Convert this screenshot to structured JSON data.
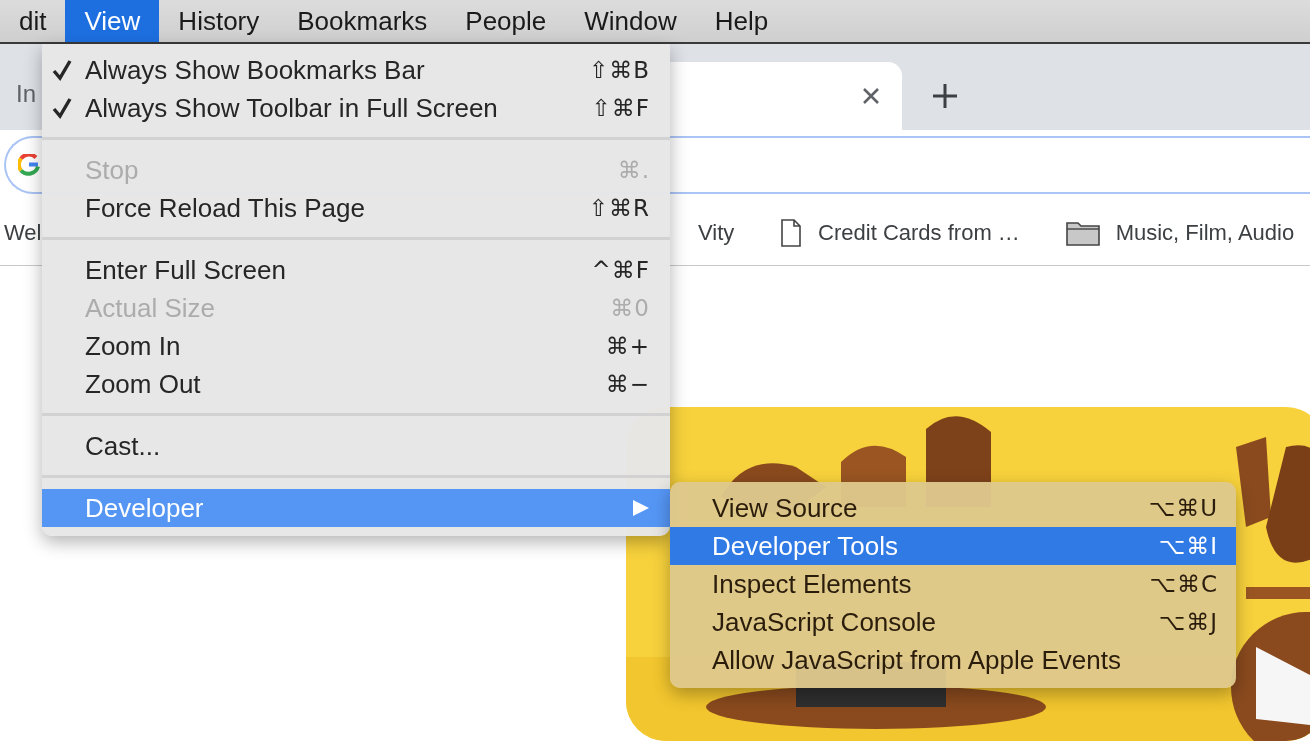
{
  "menu_bar": [
    {
      "label": "dit",
      "selected": false
    },
    {
      "label": "View",
      "selected": true
    },
    {
      "label": "History",
      "selected": false
    },
    {
      "label": "Bookmarks",
      "selected": false
    },
    {
      "label": "People",
      "selected": false
    },
    {
      "label": "Window",
      "selected": false
    },
    {
      "label": "Help",
      "selected": false
    }
  ],
  "tab_strip": {
    "background_tab_label": "In"
  },
  "bookmarks_bar": [
    {
      "label": "Wel",
      "kind": "plain"
    },
    {
      "label": "Vity",
      "kind": "plain"
    },
    {
      "label": "Credit Cards from …",
      "kind": "page"
    },
    {
      "label": "Music, Film, Audio",
      "kind": "folder"
    }
  ],
  "view_menu": {
    "groups": [
      {
        "items": [
          {
            "label": "Always Show Bookmarks Bar",
            "shortcut": "⇧⌘B",
            "checked": true,
            "disabled": false,
            "selected": false,
            "submenu": false
          },
          {
            "label": "Always Show Toolbar in Full Screen",
            "shortcut": "⇧⌘F",
            "checked": true,
            "disabled": false,
            "selected": false,
            "submenu": false
          }
        ]
      },
      {
        "items": [
          {
            "label": "Stop",
            "shortcut": "⌘.",
            "checked": false,
            "disabled": true,
            "selected": false,
            "submenu": false
          },
          {
            "label": "Force Reload This Page",
            "shortcut": "⇧⌘R",
            "checked": false,
            "disabled": false,
            "selected": false,
            "submenu": false
          }
        ]
      },
      {
        "items": [
          {
            "label": "Enter Full Screen",
            "shortcut": "^⌘F",
            "checked": false,
            "disabled": false,
            "selected": false,
            "submenu": false
          },
          {
            "label": "Actual Size",
            "shortcut": "⌘0",
            "checked": false,
            "disabled": true,
            "selected": false,
            "submenu": false
          },
          {
            "label": "Zoom In",
            "shortcut": "⌘+",
            "checked": false,
            "disabled": false,
            "selected": false,
            "submenu": false
          },
          {
            "label": "Zoom Out",
            "shortcut": "⌘−",
            "checked": false,
            "disabled": false,
            "selected": false,
            "submenu": false
          }
        ]
      },
      {
        "items": [
          {
            "label": "Cast...",
            "checked": false,
            "disabled": false,
            "selected": false,
            "submenu": false
          }
        ]
      },
      {
        "items": [
          {
            "label": "Developer",
            "checked": false,
            "disabled": false,
            "selected": true,
            "submenu": true
          }
        ]
      }
    ]
  },
  "developer_submenu": {
    "items": [
      {
        "label": "View Source",
        "shortcut": "⌥⌘U",
        "selected": false
      },
      {
        "label": "Developer Tools",
        "shortcut": "⌥⌘I",
        "selected": true
      },
      {
        "label": "Inspect Elements",
        "shortcut": "⌥⌘C",
        "selected": false
      },
      {
        "label": "JavaScript Console",
        "shortcut": "⌥⌘J",
        "selected": false
      },
      {
        "label": "Allow JavaScript from Apple Events",
        "selected": false
      }
    ]
  }
}
